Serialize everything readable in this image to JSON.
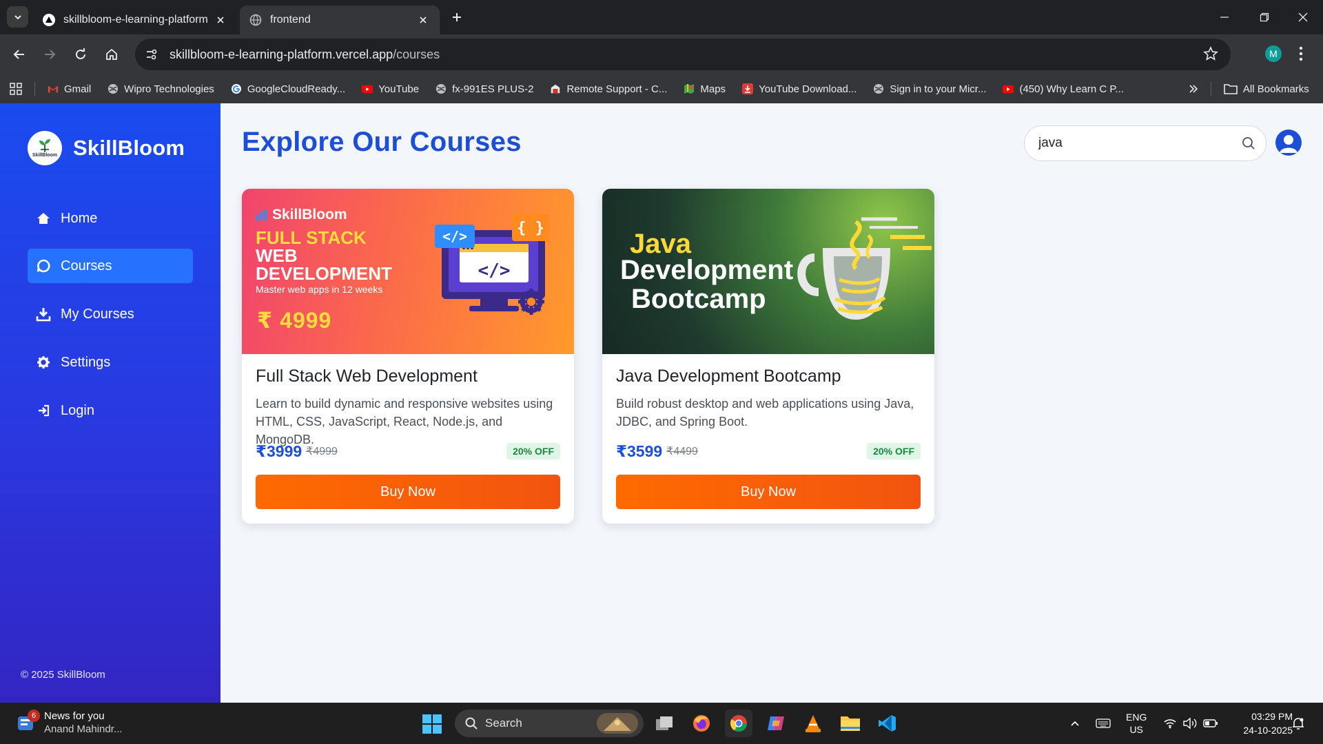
{
  "browser": {
    "tabs": [
      {
        "title": "skillbloom-e-learning-platform",
        "active": false
      },
      {
        "title": "frontend",
        "active": true
      }
    ],
    "url_host": "skillbloom-e-learning-platform.vercel.app",
    "url_path": "/courses",
    "profile_initial": "M",
    "bookmarks": [
      {
        "label": "Gmail",
        "icon": "gmail-icon"
      },
      {
        "label": "Wipro Technologies",
        "icon": "globe-icon"
      },
      {
        "label": "GoogleCloudReady...",
        "icon": "google-icon"
      },
      {
        "label": "YouTube",
        "icon": "youtube-icon"
      },
      {
        "label": "fx-991ES PLUS-2",
        "icon": "globe-icon"
      },
      {
        "label": "Remote Support - C...",
        "icon": "remote-icon"
      },
      {
        "label": "Maps",
        "icon": "maps-icon"
      },
      {
        "label": "YouTube Download...",
        "icon": "download-icon"
      },
      {
        "label": "Sign in to your Micr...",
        "icon": "globe-icon"
      },
      {
        "label": "(450) Why Learn C P...",
        "icon": "youtube-icon"
      }
    ],
    "all_bookmarks": "All Bookmarks"
  },
  "sidebar": {
    "brand": "SkillBloom",
    "logo_text": "SkillBloom",
    "items": [
      {
        "label": "Home",
        "icon": "home-icon",
        "active": false
      },
      {
        "label": "Courses",
        "icon": "courses-icon",
        "active": true
      },
      {
        "label": "My Courses",
        "icon": "download-icon",
        "active": false
      },
      {
        "label": "Settings",
        "icon": "gear-icon",
        "active": false
      },
      {
        "label": "Login",
        "icon": "login-icon",
        "active": false
      }
    ],
    "copyright": "© 2025 SkillBloom"
  },
  "main": {
    "title": "Explore Our Courses",
    "search_value": "java"
  },
  "courses": [
    {
      "title": "Full Stack Web Development",
      "description": "Learn to build dynamic and responsive websites using HTML, CSS, JavaScript, React, Node.js, and MongoDB.",
      "price": "₹3999",
      "old_price": "₹4999",
      "discount": "20% OFF",
      "button": "Buy Now",
      "banner": {
        "brand": "SkillBloom",
        "line1": "FULL STACK",
        "line2": "WEB",
        "line3": "DEVELOPMENT",
        "sub": "Master web apps in 12 weeks",
        "price": "₹ 4999",
        "code_tag": "</>",
        "braces": "{ }"
      }
    },
    {
      "title": "Java Development Bootcamp",
      "description": "Build robust desktop and web applications using Java, JDBC, and Spring Boot.",
      "price": "₹3599",
      "old_price": "₹4499",
      "discount": "20% OFF",
      "button": "Buy Now",
      "banner": {
        "line1": "Java",
        "line2": "Development",
        "line3": "Bootcamp"
      }
    }
  ],
  "taskbar": {
    "news_title": "News for you",
    "news_sub": "Anand Mahindr...",
    "news_badge": "6",
    "search_label": "Search",
    "lang_top": "ENG",
    "lang_bottom": "US",
    "time": "03:29 PM",
    "date": "24-10-2025"
  }
}
